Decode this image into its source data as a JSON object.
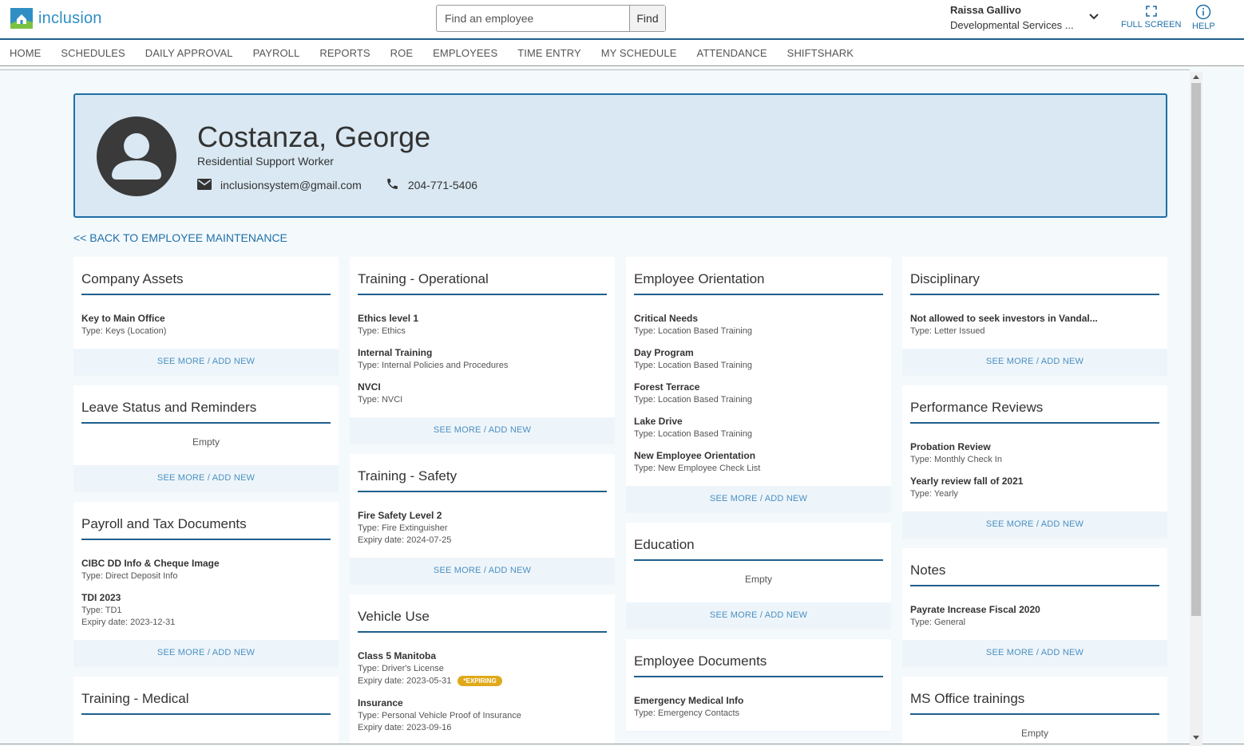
{
  "app": {
    "logo_text": "inclusion",
    "search_placeholder": "Find an employee",
    "search_button": "Find",
    "user_name": "Raissa Gallivo",
    "user_org": "Developmental Services ...",
    "fullscreen_label": "FULL SCREEN",
    "help_label": "HELP",
    "brand_color": "#1f5f8b"
  },
  "nav": [
    "HOME",
    "SCHEDULES",
    "DAILY APPROVAL",
    "PAYROLL",
    "REPORTS",
    "ROE",
    "EMPLOYEES",
    "TIME ENTRY",
    "MY SCHEDULE",
    "ATTENDANCE",
    "SHIFTSHARK"
  ],
  "profile": {
    "name": "Costanza, George",
    "title": "Residential Support Worker",
    "email": "inclusionsystem@gmail.com",
    "phone": "204-771-5406"
  },
  "back_link": "<< BACK TO EMPLOYEE MAINTENANCE",
  "see_more": "SEE MORE / ADD NEW",
  "empty_text": "Empty",
  "cards": {
    "company_assets": {
      "title": "Company Assets",
      "items": [
        {
          "name": "Key to Main Office",
          "type": "Type: Keys (Location)"
        }
      ]
    },
    "leave": {
      "title": "Leave Status and Reminders"
    },
    "payroll": {
      "title": "Payroll and Tax Documents",
      "items": [
        {
          "name": "CIBC DD Info & Cheque Image",
          "type": "Type: Direct Deposit Info"
        },
        {
          "name": "TDI 2023",
          "type": "Type: TD1",
          "expiry": "Expiry date: 2023-12-31"
        }
      ]
    },
    "training_medical": {
      "title": "Training - Medical"
    },
    "training_operational": {
      "title": "Training - Operational",
      "items": [
        {
          "name": "Ethics level 1",
          "type": "Type: Ethics"
        },
        {
          "name": "Internal Training",
          "type": "Type: Internal Policies and Procedures"
        },
        {
          "name": "NVCI",
          "type": "Type: NVCI"
        }
      ]
    },
    "training_safety": {
      "title": "Training - Safety",
      "items": [
        {
          "name": "Fire Safety Level 2",
          "type": "Type: Fire Extinguisher",
          "expiry": "Expiry date: 2024-07-25"
        }
      ]
    },
    "vehicle_use": {
      "title": "Vehicle Use",
      "badge": "*EXPIRING",
      "items": [
        {
          "name": "Class 5 Manitoba",
          "type": "Type: Driver's License",
          "expiry": "Expiry date: 2023-05-31"
        },
        {
          "name": "Insurance",
          "type": "Type: Personal Vehicle Proof of Insurance",
          "expiry": "Expiry date: 2023-09-16"
        }
      ]
    },
    "orientation": {
      "title": "Employee Orientation",
      "items": [
        {
          "name": "Critical Needs",
          "type": "Type: Location Based Training"
        },
        {
          "name": "Day Program",
          "type": "Type: Location Based Training"
        },
        {
          "name": "Forest Terrace",
          "type": "Type: Location Based Training"
        },
        {
          "name": "Lake Drive",
          "type": "Type: Location Based Training"
        },
        {
          "name": "New Employee Orientation",
          "type": "Type: New Employee Check List"
        }
      ]
    },
    "education": {
      "title": "Education"
    },
    "employee_documents": {
      "title": "Employee Documents",
      "items": [
        {
          "name": "Emergency Medical Info",
          "type": "Type: Emergency Contacts"
        }
      ]
    },
    "disciplinary": {
      "title": "Disciplinary",
      "items": [
        {
          "name": "Not allowed to seek investors in Vandal...",
          "type": "Type: Letter Issued"
        }
      ]
    },
    "performance": {
      "title": "Performance Reviews",
      "items": [
        {
          "name": "Probation Review",
          "type": "Type: Monthly Check In"
        },
        {
          "name": "Yearly review fall of 2021",
          "type": "Type: Yearly"
        }
      ]
    },
    "notes": {
      "title": "Notes",
      "items": [
        {
          "name": "Payrate Increase Fiscal 2020",
          "type": "Type: General"
        }
      ]
    },
    "ms_office": {
      "title": "MS Office trainings"
    }
  }
}
